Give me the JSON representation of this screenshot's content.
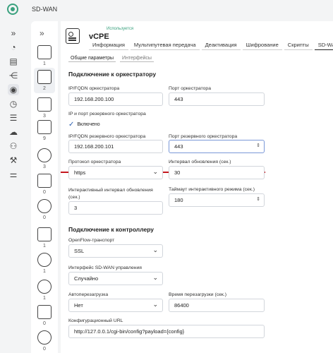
{
  "app": {
    "title": "SD-WAN"
  },
  "device": {
    "name": "vCPE",
    "status": "Используется"
  },
  "tabs": [
    "Информация",
    "Мультипутевая передача",
    "Деактивация",
    "Шифрование",
    "Скрипты",
    "SD-WAN"
  ],
  "subtabs": [
    "Общие параметры",
    "Интерфейсы"
  ],
  "device_counts": [
    "1",
    "2",
    "3",
    "9",
    "3",
    "0",
    "0",
    "1",
    "1",
    "1",
    "0",
    "0"
  ],
  "sections": {
    "orch": "Подключение к оркестратору",
    "ctrl": "Подключение к контроллеру"
  },
  "fields": {
    "ip_orch": {
      "label": "IP/FQDN оркестратора",
      "value": "192.168.200.100"
    },
    "port_orch": {
      "label": "Порт оркестратора",
      "value": "443"
    },
    "backup_check": {
      "label": "IP и порт резервного оркестратора",
      "value": "Включено"
    },
    "ip_backup": {
      "label": "IP/FQDN резервного оркестратора",
      "value": "192.168.200.101"
    },
    "port_backup": {
      "label": "Порт резервного оркестратора",
      "value": "443"
    },
    "proto": {
      "label": "Протокол оркестратора",
      "value": "https"
    },
    "update_interval": {
      "label": "Интервал обновления (сек.)",
      "value": "30"
    },
    "interactive_interval": {
      "label": "Интерактивный интервал обновления (сек.)",
      "value": "3"
    },
    "interactive_timeout": {
      "label": "Таймаут интерактивного режима (сек.)",
      "value": "180"
    },
    "openflow": {
      "label": "OpenFlow-транспорт",
      "value": "SSL"
    },
    "mgmt_iface": {
      "label": "Интерфейс SD-WAN управления",
      "value": "Случайно"
    },
    "autoreboot": {
      "label": "Автоперезагрузка",
      "value": "Нет"
    },
    "reboot_time": {
      "label": "Время перезагрузки (сек.)",
      "value": "86400"
    },
    "config_url": {
      "label": "Конфигурационный URL",
      "value": "http://127.0.0.1/cgi-bin/config?payload={config}"
    }
  }
}
